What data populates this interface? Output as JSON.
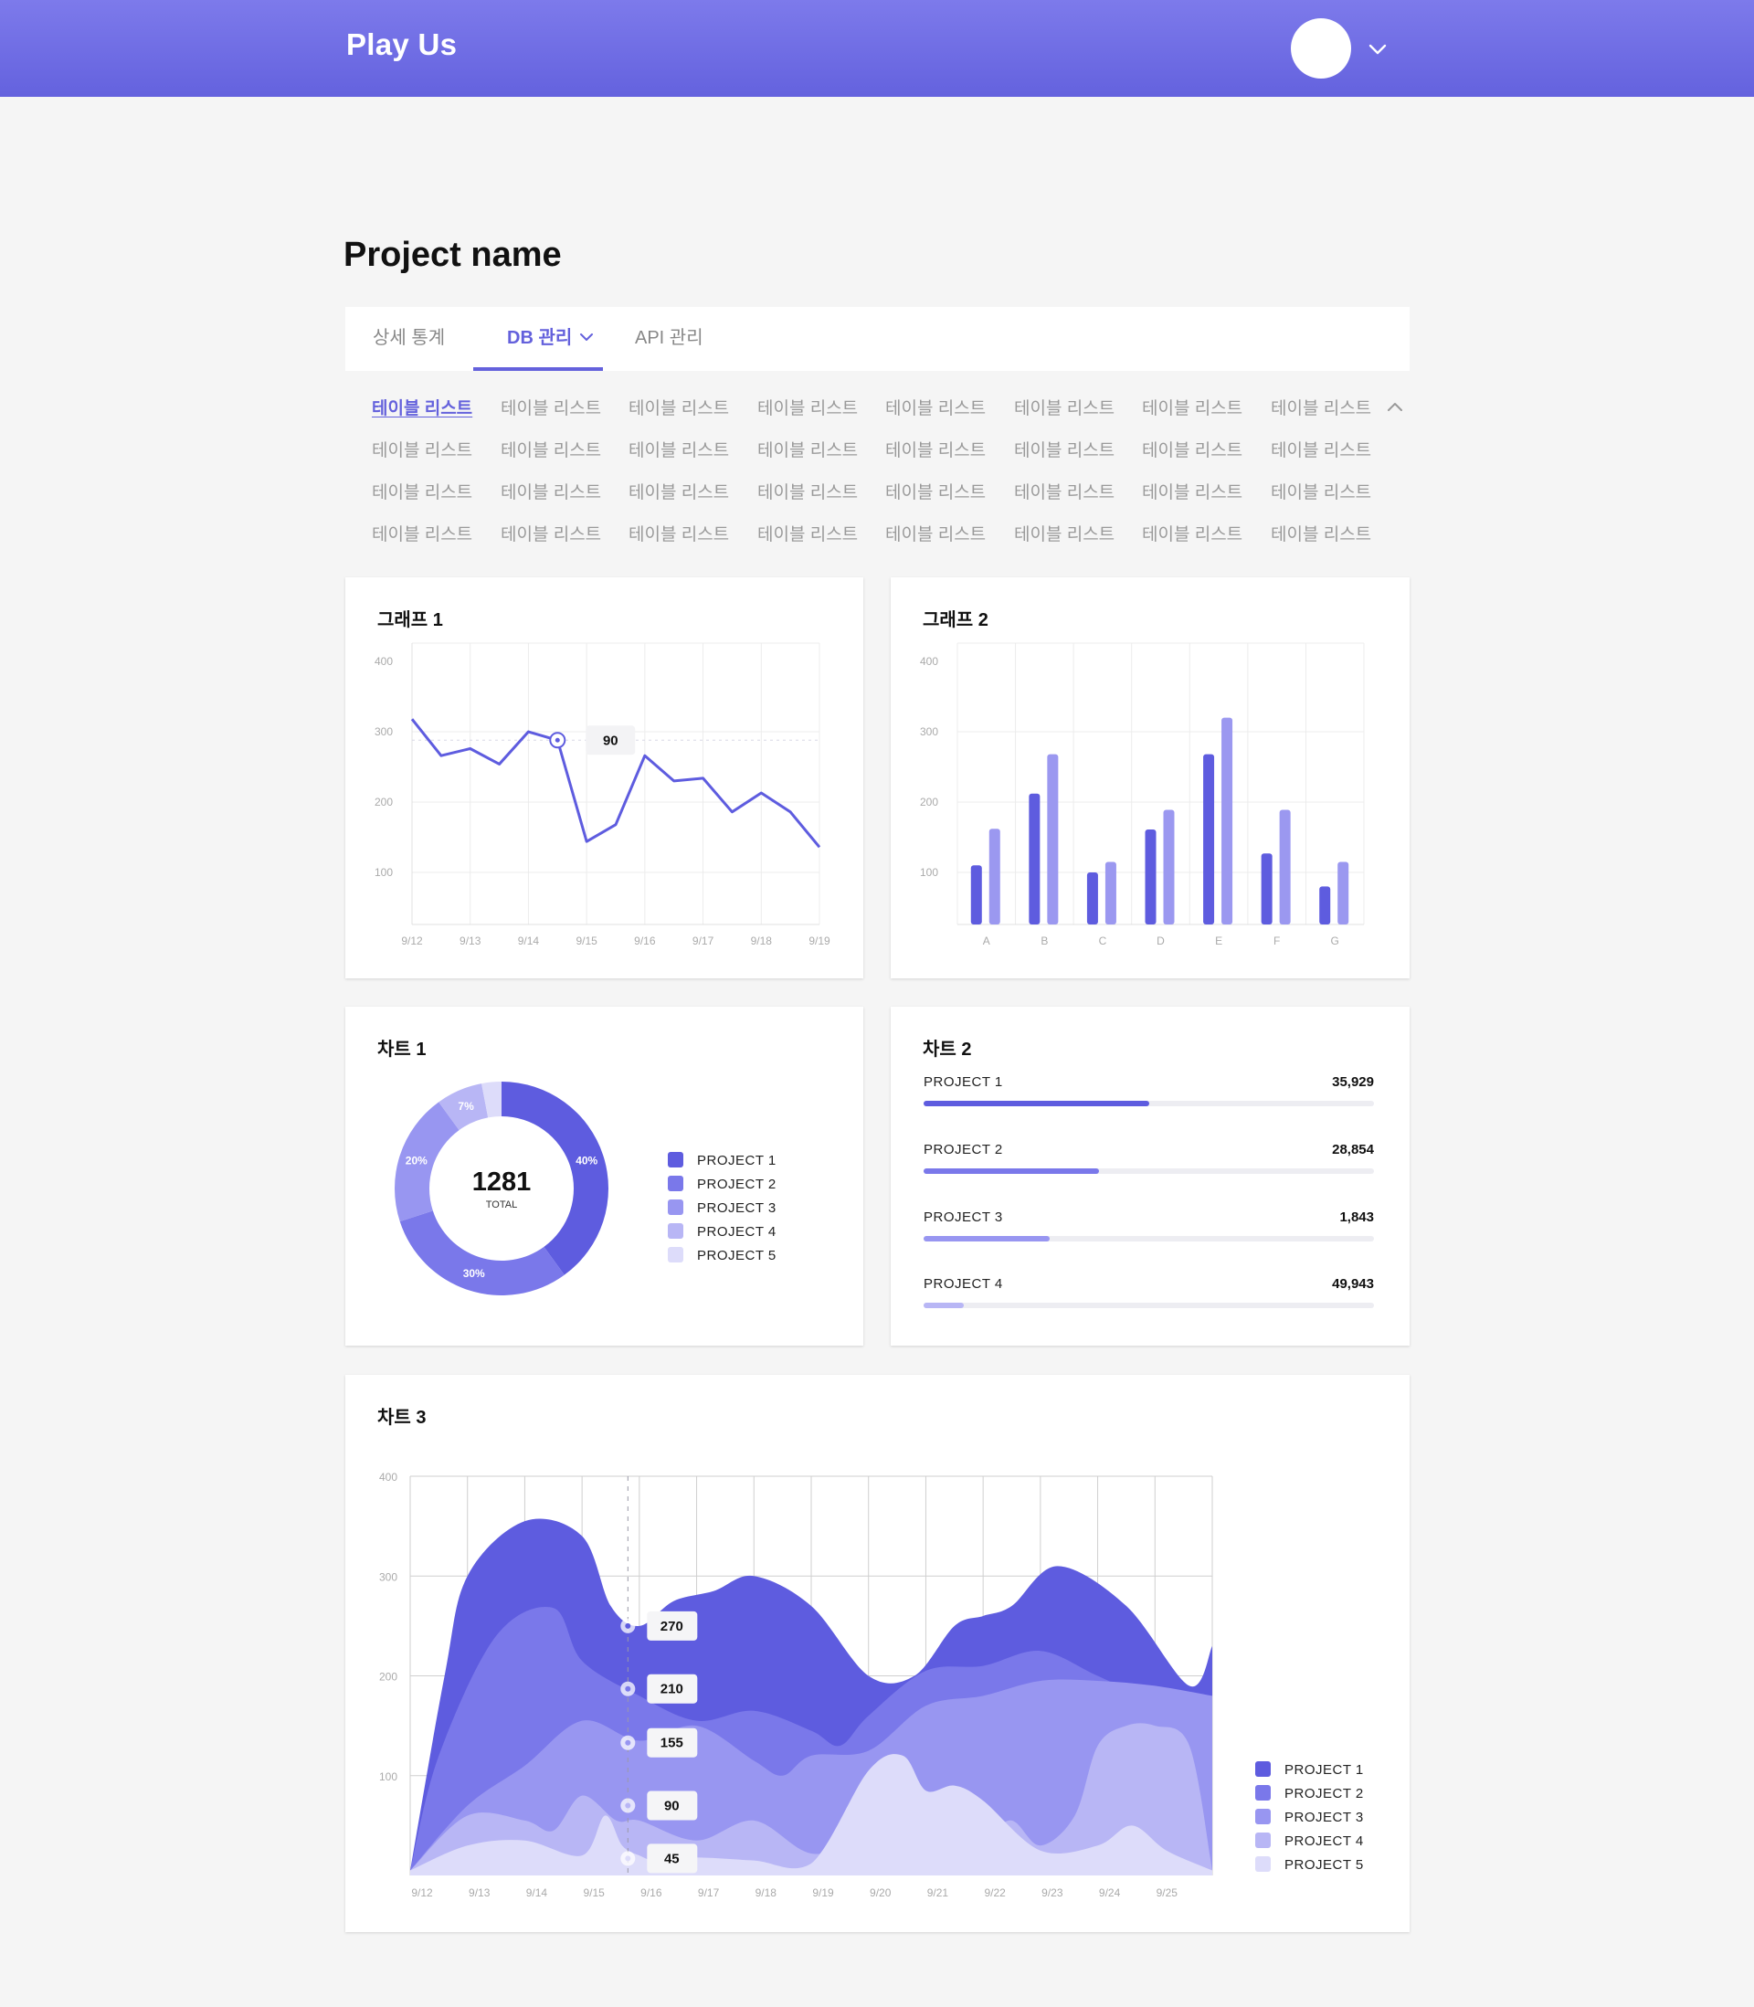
{
  "app": {
    "brand": "Play Us"
  },
  "page": {
    "title": "Project name"
  },
  "tabs": [
    {
      "label": "상세 통계",
      "active": false
    },
    {
      "label": "DB 관리",
      "active": true
    },
    {
      "label": "API 관리",
      "active": false
    }
  ],
  "table_list": {
    "rows": [
      [
        "테이블 리스트",
        "테이블 리스트",
        "테이블 리스트",
        "테이블 리스트",
        "테이블 리스트",
        "테이블 리스트",
        "테이블 리스트",
        "테이블 리스트"
      ],
      [
        "테이블 리스트",
        "테이블 리스트",
        "테이블 리스트",
        "테이블 리스트",
        "테이블 리스트",
        "테이블 리스트",
        "테이블 리스트",
        "테이블 리스트"
      ],
      [
        "테이블 리스트",
        "테이블 리스트",
        "테이블 리스트",
        "테이블 리스트",
        "테이블 리스트",
        "테이블 리스트",
        "테이블 리스트",
        "테이블 리스트"
      ],
      [
        "테이블 리스트",
        "테이블 리스트",
        "테이블 리스트",
        "테이블 리스트",
        "테이블 리스트",
        "테이블 리스트",
        "테이블 리스트",
        "테이블 리스트"
      ]
    ],
    "active_index": 0
  },
  "colors": {
    "p1": "#5e5cdf",
    "p2": "#7a78ea",
    "p3": "#9896f1",
    "p4": "#b8b6f5",
    "p5": "#dddcfa",
    "bar_light": "#9b98f0"
  },
  "cards": {
    "graph1_title": "그래프 1",
    "graph2_title": "그래프 2",
    "chart1_title": "차트 1",
    "chart2_title": "차트 2",
    "chart3_title": "차트 3"
  },
  "chart_data": [
    {
      "id": "graph1",
      "type": "line",
      "title": "그래프 1",
      "x": [
        "9/12",
        "9/12.5",
        "9/13",
        "9/13.5",
        "9/14",
        "9/14.3",
        "9/15",
        "9/15.5",
        "9/16",
        "9/16.5",
        "9/17",
        "9/17.5",
        "9/18",
        "9/18.5",
        "9/19"
      ],
      "x_labels": [
        "9/12",
        "9/13",
        "9/14",
        "9/15",
        "9/16",
        "9/17",
        "9/18",
        "9/19"
      ],
      "values": [
        292,
        240,
        250,
        228,
        274,
        262,
        118,
        142,
        240,
        204,
        208,
        160,
        187,
        160,
        110
      ],
      "ylim": [
        0,
        400
      ],
      "yticks": [
        100,
        200,
        300,
        400
      ],
      "highlight": {
        "index": 5,
        "label": "90"
      },
      "grid": true
    },
    {
      "id": "graph2",
      "type": "bar",
      "title": "그래프 2",
      "categories": [
        "A",
        "B",
        "C",
        "D",
        "E",
        "F",
        "G"
      ],
      "series": [
        {
          "values": [
            110,
            212,
            100,
            161,
            268,
            127,
            80
          ]
        },
        {
          "values": [
            162,
            268,
            115,
            189,
            320,
            189,
            115
          ]
        }
      ],
      "ylim": [
        0,
        400
      ],
      "yticks": [
        100,
        200,
        300,
        400
      ],
      "grid": true
    },
    {
      "id": "chart1",
      "type": "pie",
      "title": "차트 1",
      "total": "1281",
      "total_label": "TOTAL",
      "slices": [
        {
          "name": "PROJECT 1",
          "value": 40,
          "label": "40%"
        },
        {
          "name": "PROJECT 2",
          "value": 30,
          "label": "30%"
        },
        {
          "name": "PROJECT 3",
          "value": 20,
          "label": "20%"
        },
        {
          "name": "PROJECT 4",
          "value": 7,
          "label": "7%"
        },
        {
          "name": "PROJECT 5",
          "value": 3,
          "label": ""
        }
      ]
    },
    {
      "id": "chart2",
      "type": "bar",
      "title": "차트 2",
      "rows": [
        {
          "name": "PROJECT 1",
          "value": "35,929",
          "progress": 0.5
        },
        {
          "name": "PROJECT 2",
          "value": "28,854",
          "progress": 0.39
        },
        {
          "name": "PROJECT 3",
          "value": "1,843",
          "progress": 0.28
        },
        {
          "name": "PROJECT 4",
          "value": "49,943",
          "progress": 0.09
        }
      ]
    },
    {
      "id": "chart3",
      "type": "area",
      "title": "차트 3",
      "x_labels": [
        "9/12",
        "9/13",
        "9/14",
        "9/15",
        "9/16",
        "9/17",
        "9/18",
        "9/19",
        "9/20",
        "9/21",
        "9/22",
        "9/23",
        "9/24",
        "9/25"
      ],
      "ylim": [
        0,
        400
      ],
      "yticks": [
        100,
        200,
        300,
        400
      ],
      "series": [
        {
          "name": "PROJECT 1",
          "x": [
            0,
            0.6,
            1.0,
            2.0,
            3.0,
            3.5,
            4.0,
            4.6,
            5.3,
            6.0,
            7.0,
            8.0,
            8.8,
            9.5,
            10.0,
            10.5,
            11.3,
            12.5,
            13.6,
            14.0
          ],
          "values": [
            5,
            200,
            300,
            355,
            340,
            270,
            250,
            275,
            285,
            300,
            270,
            200,
            200,
            250,
            260,
            270,
            310,
            270,
            190,
            230
          ]
        },
        {
          "name": "PROJECT 2",
          "x": [
            0,
            0.5,
            1.5,
            2.5,
            3.0,
            4.0,
            5.0,
            6.0,
            7.0,
            7.5,
            8.0,
            9.0,
            10.0,
            11.0,
            12.0,
            13.0,
            14.0
          ],
          "values": [
            5,
            120,
            240,
            268,
            215,
            180,
            155,
            165,
            145,
            130,
            160,
            205,
            210,
            225,
            200,
            175,
            170
          ]
        },
        {
          "name": "PROJECT 3",
          "x": [
            0,
            1.0,
            2.0,
            3.0,
            4.0,
            5.0,
            6.0,
            6.5,
            7.0,
            8.0,
            9.0,
            10.0,
            11.0,
            12.0,
            13.0,
            14.0
          ],
          "values": [
            5,
            70,
            110,
            155,
            135,
            150,
            115,
            100,
            120,
            125,
            170,
            180,
            195,
            195,
            190,
            180
          ]
        },
        {
          "name": "PROJECT 4",
          "x": [
            0,
            1.0,
            2.0,
            2.5,
            3.0,
            3.6,
            4.0,
            5.0,
            6.0,
            7.0,
            8.0,
            9.0,
            10.0,
            10.5,
            11.0,
            11.6,
            12.0,
            12.5,
            13.0,
            13.6,
            14.0
          ],
          "values": [
            5,
            60,
            55,
            45,
            80,
            55,
            55,
            35,
            55,
            22,
            35,
            40,
            40,
            55,
            30,
            60,
            130,
            150,
            150,
            130,
            5
          ]
        },
        {
          "name": "PROJECT 5",
          "x": [
            0,
            1.0,
            2.0,
            3.0,
            3.4,
            3.7,
            4.0,
            4.3,
            5.0,
            6.0,
            7.0,
            8.0,
            8.6,
            9.0,
            9.5,
            10.0,
            11.0,
            12.0,
            12.6,
            13.2,
            14.0
          ],
          "values": [
            5,
            30,
            35,
            20,
            60,
            30,
            20,
            15,
            18,
            15,
            12,
            105,
            120,
            85,
            90,
            75,
            25,
            30,
            50,
            25,
            5
          ]
        }
      ],
      "highlight": {
        "x": 3.8,
        "labels": [
          "270",
          "210",
          "155",
          "90",
          "45"
        ]
      },
      "grid": true
    }
  ]
}
